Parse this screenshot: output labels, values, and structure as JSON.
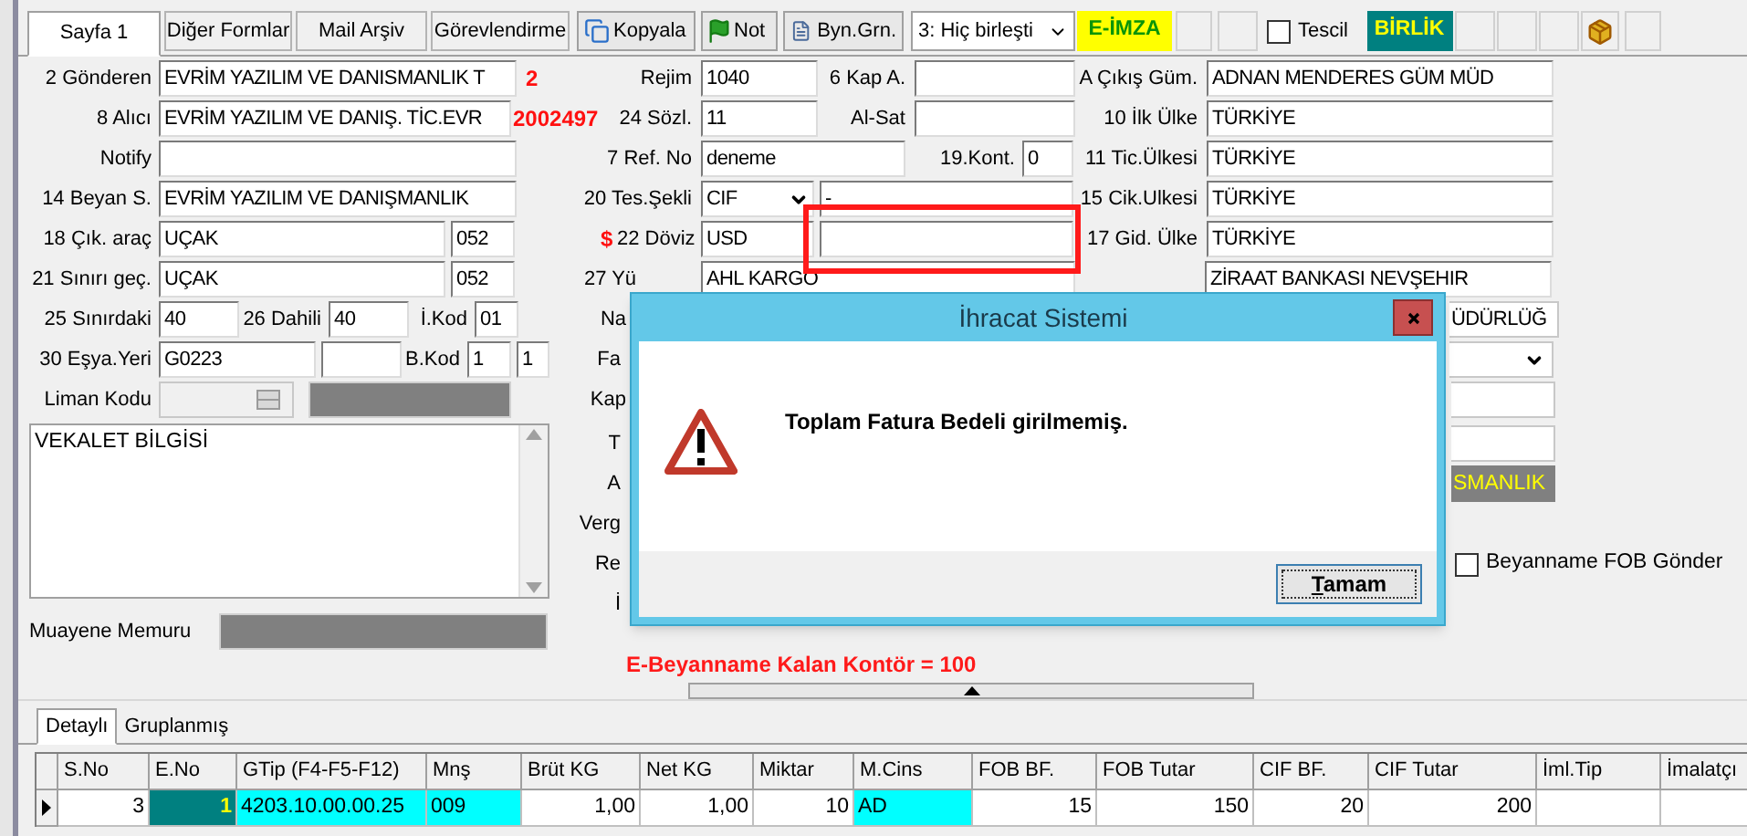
{
  "toolbar": {
    "tabs": [
      {
        "label": "Sayfa 1",
        "selected": true
      },
      {
        "label": "Diğer Formlar",
        "selected": false
      },
      {
        "label": "Mail Arşiv",
        "selected": false
      },
      {
        "label": "Görevlendirme",
        "selected": false
      }
    ],
    "copy_button": {
      "label": "Kopyala"
    },
    "note_button": {
      "label": "Not"
    },
    "declaration_button": {
      "label": "Byn.Grn."
    },
    "merge_select": {
      "value": "3: Hiç birleşti"
    },
    "e_signature": {
      "label": "E-İMZA"
    },
    "registration_check": {
      "label": "Tescil",
      "checked": false
    },
    "union_badge": {
      "label": "BİRLİK"
    }
  },
  "form": {
    "rows": [
      {
        "items": [
          {
            "kind": "label",
            "text": "2 Gönderen"
          },
          {
            "kind": "field",
            "value": "EVRİM YAZILIM VE DANISMANLIK T"
          },
          {
            "kind": "note",
            "text": "2"
          },
          {
            "kind": "label",
            "text": "Rejim"
          },
          {
            "kind": "field",
            "value": "1040"
          },
          {
            "kind": "label",
            "text": "6 Kap A."
          },
          {
            "kind": "field"
          },
          {
            "kind": "label",
            "text": "A Çıkış Güm."
          },
          {
            "kind": "field",
            "value": "ADNAN MENDERES GÜM MÜD"
          }
        ]
      },
      {
        "items": [
          {
            "kind": "label",
            "text": "8 Alıcı"
          },
          {
            "kind": "field",
            "value": "EVRİM YAZILIM VE DANIŞ. TİC.EVR"
          },
          {
            "kind": "note",
            "text": "2002497"
          },
          {
            "kind": "label",
            "text": "24 Sözl."
          },
          {
            "kind": "field",
            "value": "11"
          },
          {
            "kind": "label",
            "text": "Al-Sat"
          },
          {
            "kind": "field"
          },
          {
            "kind": "label",
            "text": "10 İlk Ülke"
          },
          {
            "kind": "field",
            "value": "TÜRKİYE"
          }
        ]
      },
      {
        "items": [
          {
            "kind": "label",
            "text": "Notify"
          },
          {
            "kind": "field"
          },
          {
            "kind": "label",
            "text": "7 Ref. No"
          },
          {
            "kind": "field",
            "value": "deneme"
          },
          {
            "kind": "label",
            "text": "19.Kont."
          },
          {
            "kind": "field",
            "value": "0"
          },
          {
            "kind": "label",
            "text": "11 Tic.Ülkesi"
          },
          {
            "kind": "field",
            "value": "TÜRKİYE"
          }
        ]
      },
      {
        "items": [
          {
            "kind": "label",
            "text": "14 Beyan S."
          },
          {
            "kind": "field",
            "value": "EVRİM YAZILIM VE DANIŞMANLIK"
          },
          {
            "kind": "label",
            "text": "20 Tes.Şekli"
          },
          {
            "kind": "select",
            "value": "CIF"
          },
          {
            "kind": "field",
            "value": "-"
          },
          {
            "kind": "label",
            "text": "15 Cik.Ulkesi"
          },
          {
            "kind": "field",
            "value": "TÜRKİYE"
          }
        ]
      },
      {
        "items": [
          {
            "kind": "label",
            "text": "18 Çık. araç"
          },
          {
            "kind": "field",
            "value": "UÇAK"
          },
          {
            "kind": "field",
            "value": "052"
          },
          {
            "kind": "note",
            "text": "$"
          },
          {
            "kind": "label",
            "text": "22 Döviz"
          },
          {
            "kind": "field",
            "value": "USD"
          },
          {
            "kind": "flagged"
          },
          {
            "kind": "label",
            "text": "17 Gid. Ülke"
          },
          {
            "kind": "field",
            "value": "TÜRKİYE"
          }
        ]
      },
      {
        "items": [
          {
            "kind": "label",
            "text": "21 Sınırı geç."
          },
          {
            "kind": "field",
            "value": "UÇAK"
          },
          {
            "kind": "field",
            "value": "052"
          },
          {
            "kind": "cutlabel",
            "text": "27 Yü"
          },
          {
            "kind": "field",
            "value": "AHL KARGO"
          },
          {
            "kind": "field",
            "value": "ZİRAAT BANKASI NEVŞEHIR"
          }
        ]
      },
      {
        "items": [
          {
            "kind": "label",
            "text": "25 Sınırdaki"
          },
          {
            "kind": "field",
            "value": "40"
          },
          {
            "kind": "label",
            "text": "26 Dahili"
          },
          {
            "kind": "field",
            "value": "40"
          },
          {
            "kind": "label",
            "text": "İ.Kod"
          },
          {
            "kind": "field",
            "value": "01"
          },
          {
            "kind": "label",
            "text": "Na"
          },
          {
            "kind": "cutfield",
            "value": "ÜDÜRLÜĞ"
          }
        ]
      },
      {
        "items": [
          {
            "kind": "label",
            "text": "30 Eşya.Yeri"
          },
          {
            "kind": "field",
            "value": "G0223"
          },
          {
            "kind": "field"
          },
          {
            "kind": "label",
            "text": "B.Kod"
          },
          {
            "kind": "field",
            "value": "1"
          },
          {
            "kind": "field",
            "value": "1"
          },
          {
            "kind": "label",
            "text": "Fa"
          },
          {
            "kind": "cutselect"
          }
        ]
      },
      {
        "items": [
          {
            "kind": "label",
            "text": "Liman Kodu"
          },
          {
            "kind": "disabled"
          },
          {
            "kind": "bar"
          },
          {
            "kind": "label",
            "text": "Kap"
          },
          {
            "kind": "cutfield"
          }
        ]
      }
    ],
    "attorney_notes": {
      "value": "VEKALET BİLGİSİ"
    },
    "inspector": {
      "label": "Muayene Memuru"
    },
    "lower_labels": [
      "T",
      "A",
      "Verg",
      "Re",
      "İ"
    ],
    "lower_right": {
      "office_bar": {
        "text": "SMANLIK"
      },
      "fob_send": {
        "label": "Beyanname FOB Gönder",
        "checked": false
      }
    },
    "counter_notice": "E-Beyanname Kalan Kontör = 100"
  },
  "details": {
    "tabs": [
      {
        "label": "Detaylı",
        "selected": true
      },
      {
        "label": "Gruplanmış",
        "selected": false
      }
    ],
    "columns": [
      "S.No",
      "E.No",
      "GTip (F4-F5-F12)",
      "Mnş",
      "Brüt KG",
      "Net KG",
      "Miktar",
      "M.Cins",
      "FOB BF.",
      "FOB Tutar",
      "CIF BF.",
      "CIF Tutar",
      "İml.Tip",
      "İmalatçı"
    ],
    "rows": [
      {
        "current": true,
        "cells": [
          {
            "text": "3",
            "kind": "number"
          },
          {
            "text": "1",
            "kind": "key"
          },
          {
            "text": "4203.10.00.00.25",
            "kind": "lookup"
          },
          {
            "text": "009",
            "kind": "lookup"
          },
          {
            "text": "1,00",
            "kind": "number"
          },
          {
            "text": "1,00",
            "kind": "number"
          },
          {
            "text": "10",
            "kind": "number"
          },
          {
            "text": "AD",
            "kind": "lookup"
          },
          {
            "text": "15",
            "kind": "number"
          },
          {
            "text": "150",
            "kind": "number"
          },
          {
            "text": "20",
            "kind": "number"
          },
          {
            "text": "200",
            "kind": "number"
          },
          {
            "kind": "text"
          },
          {
            "kind": "text"
          }
        ]
      }
    ]
  },
  "dialog": {
    "title": "İhracat Sistemi",
    "message": "Toplam Fatura Bedeli girilmemiş.",
    "button": "Tamam"
  }
}
